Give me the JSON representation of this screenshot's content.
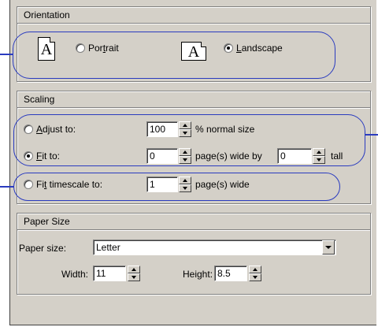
{
  "orientation": {
    "title": "Orientation",
    "portrait_label_pre": "Por",
    "portrait_label_u": "t",
    "portrait_label_post": "rait",
    "landscape_label_u": "L",
    "landscape_label_post": "andscape",
    "icon_glyph": "A",
    "selected": "landscape"
  },
  "scaling": {
    "title": "Scaling",
    "adjust_label_u": "A",
    "adjust_label_post": "djust to:",
    "adjust_value": "100",
    "adjust_suffix": "% normal size",
    "fit_label_u": "F",
    "fit_label_post": "it to:",
    "fit_wide_value": "0",
    "fit_wide_suffix": "page(s) wide by",
    "fit_tall_value": "0",
    "fit_tall_suffix": "tall",
    "timescale_label_pre": "Fi",
    "timescale_label_u": "t",
    "timescale_label_post": " timescale to:",
    "timescale_value": "1",
    "timescale_suffix": "page(s) wide",
    "selected": "fit"
  },
  "paper": {
    "title": "Paper Size",
    "size_label": "Paper size:",
    "size_value": "Letter",
    "width_label": "Width:",
    "width_value": "11",
    "height_label": "Height:",
    "height_value": "8.5"
  },
  "colors": {
    "annotation": "#2a3bbf",
    "dialog_bg": "#d4d0c8"
  }
}
